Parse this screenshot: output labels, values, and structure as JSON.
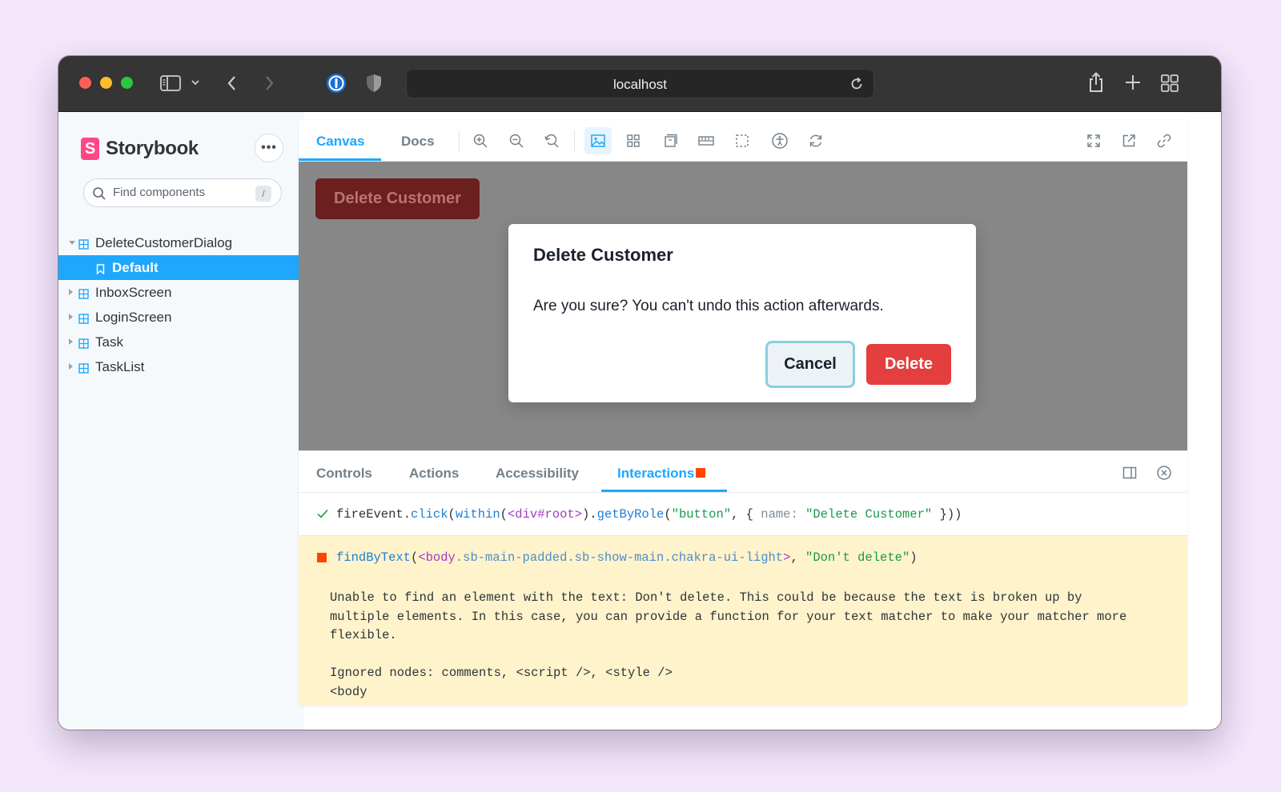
{
  "browser": {
    "url": "localhost"
  },
  "sidebar": {
    "logo_mark": "S",
    "logo_text": "Storybook",
    "menu_label": "•••",
    "search_placeholder": "Find components",
    "search_shortcut": "/",
    "items": [
      {
        "label": "DeleteCustomerDialog",
        "expanded": true
      },
      {
        "label": "Default",
        "selected": true
      },
      {
        "label": "InboxScreen"
      },
      {
        "label": "LoginScreen"
      },
      {
        "label": "Task"
      },
      {
        "label": "TaskList"
      }
    ]
  },
  "toolbar": {
    "tabs": [
      "Canvas",
      "Docs"
    ]
  },
  "canvas": {
    "background_button": "Delete Customer",
    "dialog": {
      "title": "Delete Customer",
      "body": "Are you sure? You can't undo this action afterwards.",
      "cancel": "Cancel",
      "delete": "Delete"
    }
  },
  "panel": {
    "tabs": [
      "Controls",
      "Actions",
      "Accessibility",
      "Interactions"
    ],
    "step1": {
      "fn": "fireEvent",
      "method": "click",
      "within": "within",
      "el": "<div#root>",
      "query": "getByRole",
      "arg1": "\"button\"",
      "key": "name:",
      "arg2": "\"Delete Customer\""
    },
    "step2": {
      "fn": "findByText",
      "el_tag": "<body",
      "el_classes": ".sb-main-padded.sb-show-main.chakra-ui-light",
      "el_end": ">",
      "arg": "\"Don't delete\"",
      "message": "Unable to find an element with the text: Don't delete. This could be because the text is broken up by\nmultiple elements. In this case, you can provide a function for your text matcher to make your matcher more\nflexible.\n\nIgnored nodes: comments, <script />, <style />\n<body"
    }
  },
  "colors": {
    "accent": "#1ea7fd",
    "danger": "#e53e3e",
    "error": "#ff4400",
    "brand": "#ff4785"
  }
}
